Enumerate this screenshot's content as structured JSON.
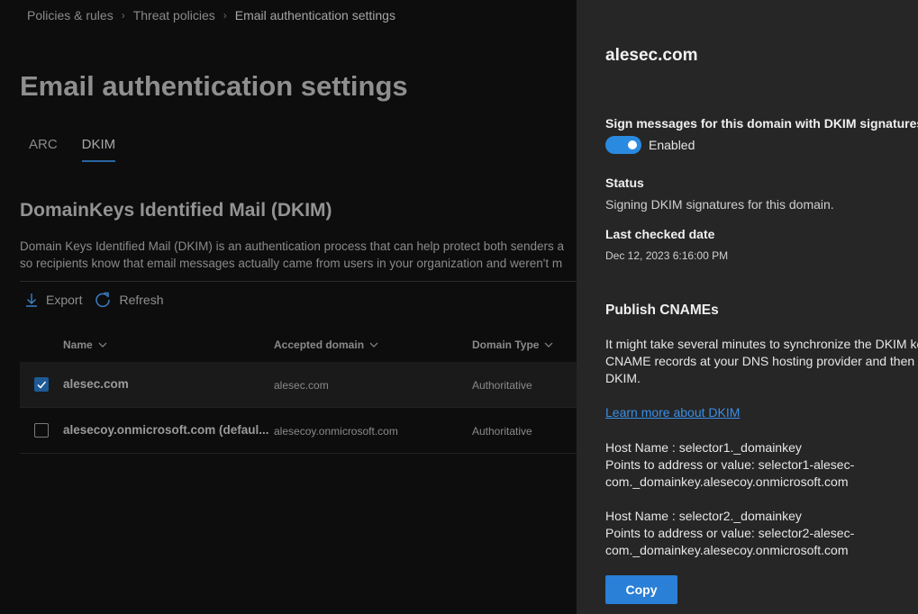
{
  "breadcrumb": {
    "items": [
      "Policies & rules",
      "Threat policies",
      "Email authentication settings"
    ]
  },
  "page": {
    "title": "Email authentication settings",
    "tabs": [
      {
        "label": "ARC",
        "active": false
      },
      {
        "label": "DKIM",
        "active": true
      }
    ],
    "section_title": "DomainKeys Identified Mail (DKIM)",
    "description_line1": "Domain Keys Identified Mail (DKIM) is an authentication process that can help protect both senders a",
    "description_line2": "so recipients know that email messages actually came from users in your organization and weren't m"
  },
  "toolbar": {
    "export_label": "Export",
    "refresh_label": "Refresh"
  },
  "table": {
    "headers": {
      "name": "Name",
      "accepted_domain": "Accepted domain",
      "domain_type": "Domain Type"
    },
    "rows": [
      {
        "name": "alesec.com",
        "accepted_domain": "alesec.com",
        "domain_type": "Authoritative",
        "checked": true
      },
      {
        "name": "alesecoy.onmicrosoft.com (defaul...",
        "accepted_domain": "alesecoy.onmicrosoft.com",
        "domain_type": "Authoritative",
        "checked": false
      }
    ]
  },
  "panel": {
    "title": "alesec.com",
    "sign_label": "Sign messages for this domain with DKIM signatures",
    "toggle_state": "Enabled",
    "status_label": "Status",
    "status_value": "Signing DKIM signatures for this domain.",
    "last_checked_label": "Last checked date",
    "last_checked_value": "Dec 12, 2023 6:16:00 PM",
    "publish_title": "Publish CNAMEs",
    "publish_line1": "It might take several minutes to synchronize the DKIM ke",
    "publish_line2": "CNAME records at your DNS hosting provider and then r",
    "publish_line3": "DKIM.",
    "learn_more": "Learn more about DKIM",
    "host1_line1": "Host Name : selector1._domainkey",
    "host1_line2": "Points to address or value: selector1-alesec-",
    "host1_line3": "com._domainkey.alesecoy.onmicrosoft.com",
    "host2_line1": "Host Name : selector2._domainkey",
    "host2_line2": "Points to address or value: selector2-alesec-",
    "host2_line3": "com._domainkey.alesecoy.onmicrosoft.com",
    "copy_label": "Copy"
  },
  "colors": {
    "accent": "#2a7fd6",
    "toggle_on": "#2a8ae0",
    "link": "#3a8ee6",
    "panel_bg": "#262626"
  }
}
